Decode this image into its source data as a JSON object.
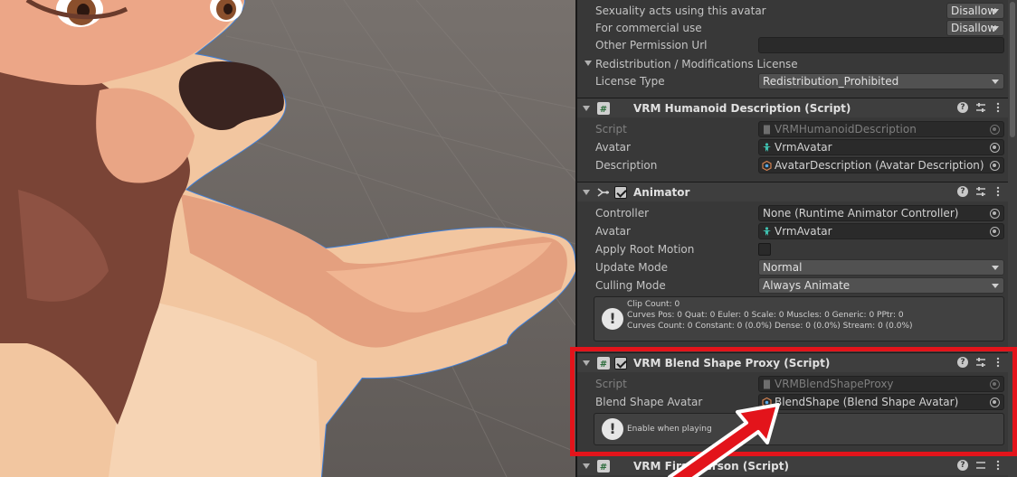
{
  "permissions": {
    "sexuality_label": "Sexuality acts using this avatar",
    "sexuality_value": "Disallow",
    "commercial_label": "For commercial use",
    "commercial_value": "Disallow",
    "other_url_label": "Other Permission Url",
    "other_url_value": ""
  },
  "license": {
    "section_label": "Redistribution / Modifications License",
    "type_label": "License Type",
    "type_value": "Redistribution_Prohibited"
  },
  "humanoid_description": {
    "title": "VRM Humanoid Description (Script)",
    "script_label": "Script",
    "script_value": "VRMHumanoidDescription",
    "avatar_label": "Avatar",
    "avatar_value": "VrmAvatar",
    "description_label": "Description",
    "description_value": "AvatarDescription (Avatar Description)"
  },
  "animator": {
    "title": "Animator",
    "enabled": true,
    "controller_label": "Controller",
    "controller_value": "None (Runtime Animator Controller)",
    "avatar_label": "Avatar",
    "avatar_value": "VrmAvatar",
    "root_motion_label": "Apply Root Motion",
    "root_motion_checked": false,
    "update_mode_label": "Update Mode",
    "update_mode_value": "Normal",
    "culling_mode_label": "Culling Mode",
    "culling_mode_value": "Always Animate",
    "info_line1": "Clip Count: 0",
    "info_line2": "Curves Pos: 0 Quat: 0 Euler: 0 Scale: 0 Muscles: 0 Generic: 0 PPtr: 0",
    "info_line3": "Curves Count: 0 Constant: 0 (0.0%) Dense: 0 (0.0%) Stream: 0 (0.0%)"
  },
  "blend_shape_proxy": {
    "title": "VRM Blend Shape Proxy (Script)",
    "enabled": true,
    "script_label": "Script",
    "script_value": "VRMBlendShapeProxy",
    "avatar_label": "Blend Shape Avatar",
    "avatar_value": "BlendShape (Blend Shape Avatar)",
    "info_message": "Enable when playing"
  },
  "first_person": {
    "title": "VRM First Person (Script)"
  },
  "colors": {
    "highlight": "#e3141b",
    "inspector_bg": "#383838",
    "field_bg": "#2a2a2a"
  }
}
